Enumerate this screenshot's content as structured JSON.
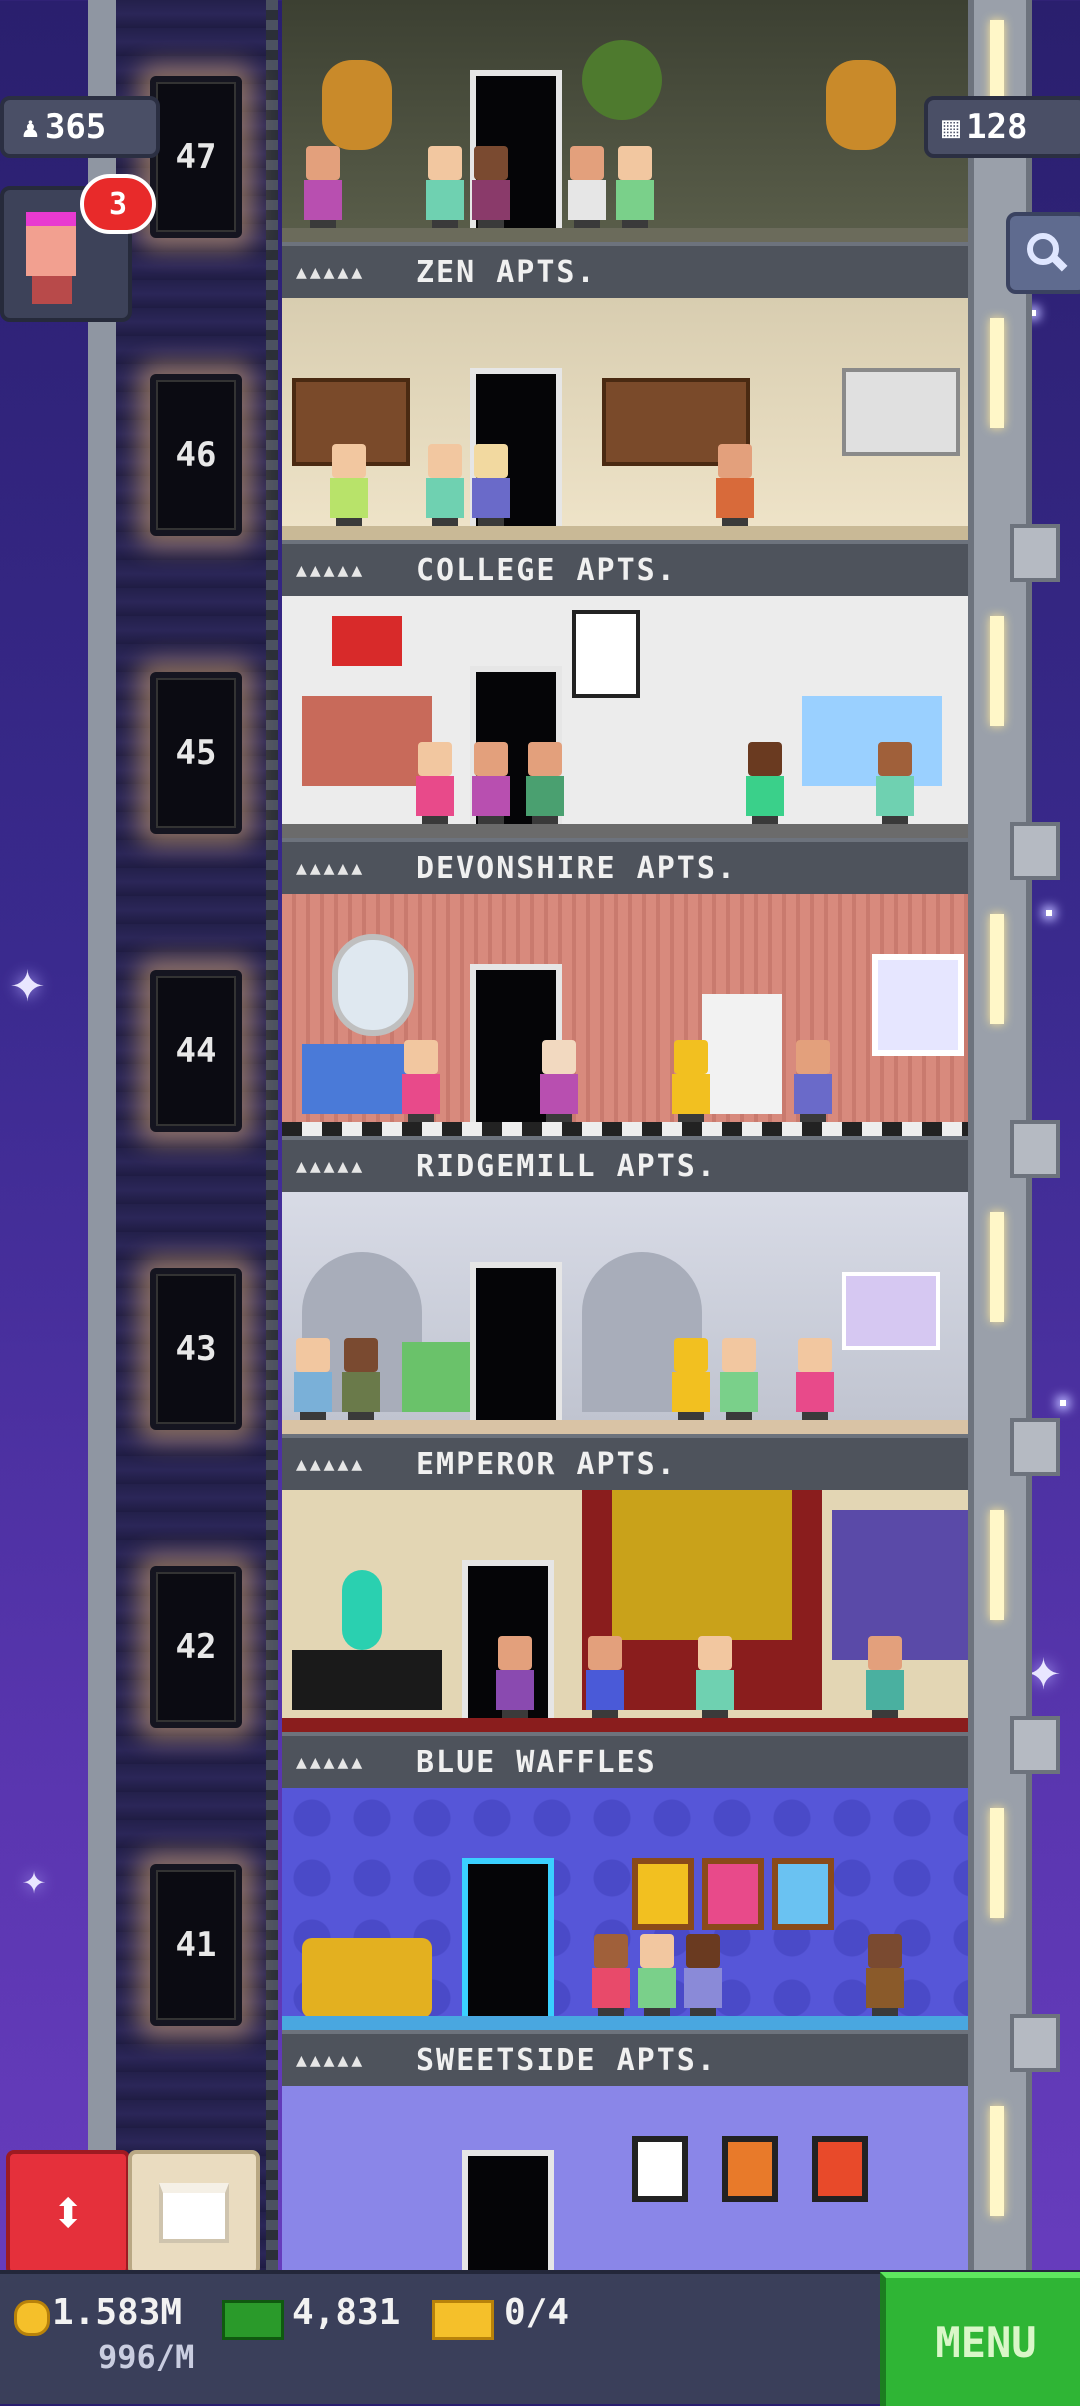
{
  "hud": {
    "population": "365",
    "floor_count": "128",
    "notification_count": "3"
  },
  "floors": [
    {
      "number": "47",
      "name": "ZEN APTS.",
      "rating": "▲▲▲▲▲",
      "wall": "#4a4e3e",
      "floor": "#6b6b5b"
    },
    {
      "number": "46",
      "name": "COLLEGE APTS.",
      "rating": "▲▲▲▲▲",
      "wall": "#e9ddc1",
      "floor": "#c9b996"
    },
    {
      "number": "45",
      "name": "DEVONSHIRE APTS.",
      "rating": "▲▲▲▲▲",
      "wall": "#eceaea",
      "floor": "#6b6b6b"
    },
    {
      "number": "44",
      "name": "RIDGEMILL APTS.",
      "rating": "▲▲▲▲▲",
      "wall": "#d88a7d",
      "floor": "#2c2c2c"
    },
    {
      "number": "43",
      "name": "EMPEROR APTS.",
      "rating": "▲▲▲▲▲",
      "wall": "#c9ccd6",
      "floor": "#d9c3a5"
    },
    {
      "number": "42",
      "name": "BLUE WAFFLES",
      "rating": "▲▲▲▲▲",
      "wall": "#e3d6b4",
      "floor": "#8a1d1d"
    },
    {
      "number": "41",
      "name": "SWEETSIDE APTS.",
      "rating": "▲▲▲▲▲",
      "wall": "#5656d8",
      "floor": "#49a7e0"
    }
  ],
  "bottom_bar": {
    "coins": "1.583M",
    "coin_rate": "996/M",
    "bux": "4,831",
    "tickets": "0/4",
    "menu_label": "MENU"
  },
  "colors": {
    "menu_green": "#2fb535",
    "elevator_red": "#e5303b",
    "badge_red": "#e82a2a"
  }
}
